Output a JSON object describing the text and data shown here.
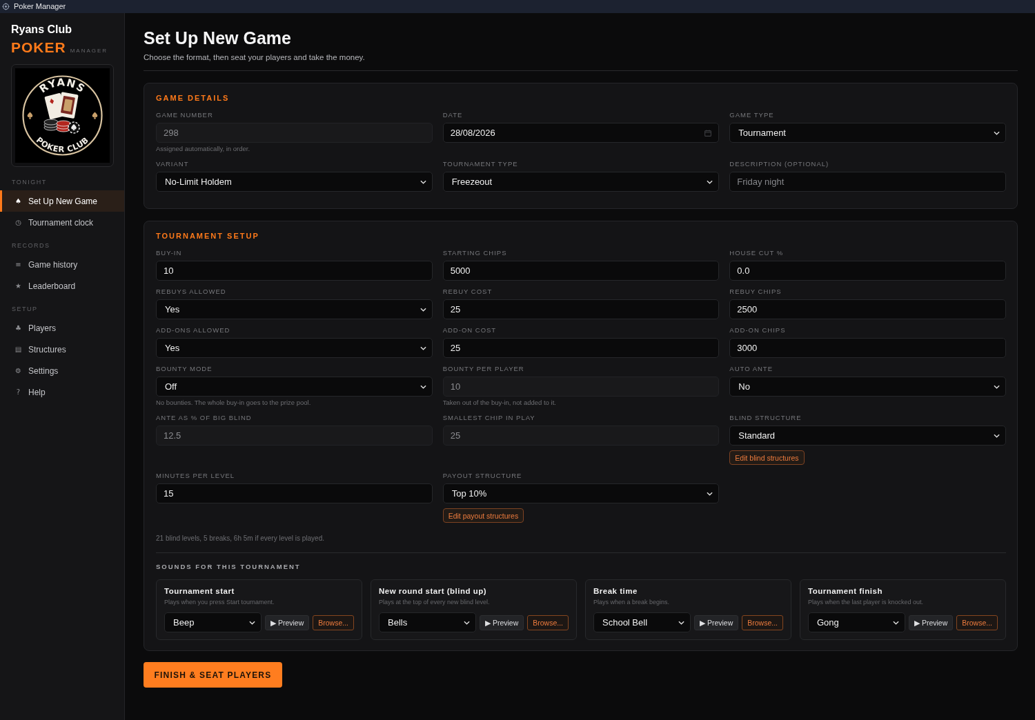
{
  "window": {
    "title": "Poker Manager"
  },
  "sidebar": {
    "club_name": "Ryans Club",
    "brand": "POKER",
    "brand_suffix": "MANAGER",
    "logo": {
      "top_text": "RYANS",
      "bottom_text": "POKER CLUB"
    },
    "sections": [
      {
        "heading": "TONIGHT",
        "items": [
          {
            "icon": "♠",
            "label": "Set Up New Game",
            "selected": true
          },
          {
            "icon": "◷",
            "label": "Tournament clock",
            "selected": false
          }
        ]
      },
      {
        "heading": "RECORDS",
        "items": [
          {
            "icon": "≡",
            "label": "Game history",
            "selected": false
          },
          {
            "icon": "★",
            "label": "Leaderboard",
            "selected": false
          }
        ]
      },
      {
        "heading": "SETUP",
        "items": [
          {
            "icon": "♣",
            "label": "Players",
            "selected": false
          },
          {
            "icon": "▤",
            "label": "Structures",
            "selected": false
          },
          {
            "icon": "⚙",
            "label": "Settings",
            "selected": false
          },
          {
            "icon": "?",
            "label": "Help",
            "selected": false
          }
        ]
      }
    ]
  },
  "page": {
    "title": "Set Up New Game",
    "subtitle": "Choose the format, then seat your players and take the money."
  },
  "game_details": {
    "heading": "GAME DETAILS",
    "fields": [
      {
        "label": "GAME NUMBER",
        "kind": "text",
        "value": "298",
        "disabled": true,
        "hint": "Assigned automatically, in order."
      },
      {
        "label": "DATE",
        "kind": "date",
        "value": "28/08/2026",
        "disabled": false
      },
      {
        "label": "GAME TYPE",
        "kind": "select",
        "value": "Tournament",
        "disabled": false
      },
      {
        "label": "VARIANT",
        "kind": "select",
        "value": "No-Limit Holdem",
        "disabled": false
      },
      {
        "label": "TOURNAMENT TYPE",
        "kind": "select",
        "value": "Freezeout",
        "disabled": false
      },
      {
        "label": "DESCRIPTION (OPTIONAL)",
        "kind": "text",
        "placeholder": "Friday night",
        "disabled": false
      }
    ]
  },
  "tournament_setup": {
    "heading": "TOURNAMENT SETUP",
    "fields": [
      {
        "label": "BUY-IN",
        "kind": "text",
        "value": "10",
        "disabled": false
      },
      {
        "label": "STARTING CHIPS",
        "kind": "text",
        "value": "5000",
        "disabled": false
      },
      {
        "label": "HOUSE CUT %",
        "kind": "text",
        "value": "0.0",
        "disabled": false
      },
      {
        "label": "REBUYS ALLOWED",
        "kind": "select",
        "value": "Yes",
        "disabled": false
      },
      {
        "label": "REBUY COST",
        "kind": "text",
        "value": "25",
        "disabled": false
      },
      {
        "label": "REBUY CHIPS",
        "kind": "text",
        "value": "2500",
        "disabled": false
      },
      {
        "label": "ADD-ONS ALLOWED",
        "kind": "select",
        "value": "Yes",
        "disabled": false
      },
      {
        "label": "ADD-ON COST",
        "kind": "text",
        "value": "25",
        "disabled": false
      },
      {
        "label": "ADD-ON CHIPS",
        "kind": "text",
        "value": "3000",
        "disabled": false
      },
      {
        "label": "BOUNTY MODE",
        "kind": "select",
        "value": "Off",
        "disabled": false,
        "hint": "No bounties. The whole buy-in goes to the prize pool."
      },
      {
        "label": "BOUNTY PER PLAYER",
        "kind": "text",
        "value": "10",
        "disabled": true,
        "hint": "Taken out of the buy-in, not added to it."
      },
      {
        "label": "AUTO ANTE",
        "kind": "select",
        "value": "No",
        "disabled": false
      },
      {
        "label": "ANTE AS % OF BIG BLIND",
        "kind": "text",
        "value": "12.5",
        "disabled": true
      },
      {
        "label": "SMALLEST CHIP IN PLAY",
        "kind": "text",
        "value": "25",
        "disabled": true
      },
      {
        "label": "BLIND STRUCTURE",
        "kind": "select",
        "value": "Standard",
        "disabled": false,
        "action": "Edit blind structures"
      },
      {
        "label": "MINUTES PER LEVEL",
        "kind": "text",
        "value": "15",
        "disabled": false
      },
      {
        "label": "PAYOUT STRUCTURE",
        "kind": "select",
        "value": "Top 10%",
        "disabled": false,
        "action": "Edit payout structures"
      }
    ],
    "summary": "21 blind levels, 5 breaks, 6h 5m if every level is played.",
    "sounds": {
      "heading": "SOUNDS FOR THIS TOURNAMENT",
      "items": [
        {
          "title": "Tournament start",
          "description": "Plays when you press Start tournament.",
          "sound": "Beep",
          "preview": "▶ Preview",
          "browse": "Browse..."
        },
        {
          "title": "New round start (blind up)",
          "description": "Plays at the top of every new blind level.",
          "sound": "Bells",
          "preview": "▶ Preview",
          "browse": "Browse..."
        },
        {
          "title": "Break time",
          "description": "Plays when a break begins.",
          "sound": "School Bell",
          "preview": "▶ Preview",
          "browse": "Browse..."
        },
        {
          "title": "Tournament finish",
          "description": "Plays when the last player is knocked out.",
          "sound": "Gong",
          "preview": "▶ Preview",
          "browse": "Browse..."
        }
      ]
    }
  },
  "finish_button": {
    "label": "FINISH & SEAT PLAYERS"
  }
}
